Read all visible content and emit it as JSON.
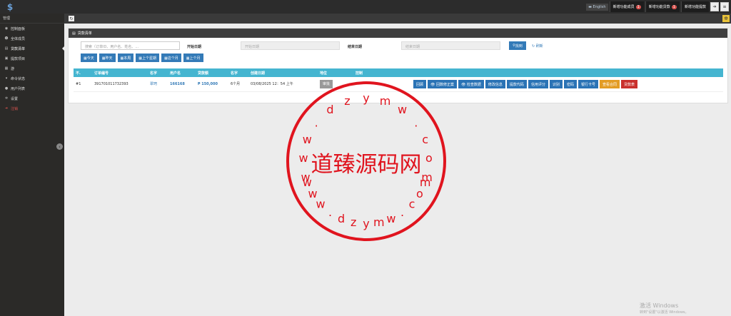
{
  "topbar": {
    "language": "English",
    "features": [
      {
        "label": "新增功能成员",
        "badge": "1"
      },
      {
        "label": "新增功能贷款",
        "badge": "1"
      },
      {
        "label": "新增功能提款",
        "badge": ""
      }
    ],
    "icons": [
      "logout-icon",
      "menu-icon"
    ]
  },
  "sidebar": {
    "header": "管理",
    "items": [
      {
        "label": "控制面板",
        "icon": "dashboard-icon"
      },
      {
        "label": "全体成员",
        "icon": "users-icon"
      },
      {
        "label": "贷款清单",
        "icon": "list-icon"
      },
      {
        "label": "提款项目",
        "icon": "money-icon"
      },
      {
        "label": "游",
        "icon": "grid-icon"
      },
      {
        "label": "命令状态",
        "icon": "cart-icon"
      },
      {
        "label": "用户列表",
        "icon": "user-icon"
      },
      {
        "label": "设置",
        "icon": "gear-icon"
      },
      {
        "label": "注销",
        "icon": "logout-icon"
      }
    ]
  },
  "panel": {
    "title": "贷款清单",
    "search_placeholder": "搜索（订单ID、用户名、姓名、...",
    "start_label": "开始日期",
    "start_placeholder": "开始日期",
    "end_label": "结束日期",
    "end_placeholder": "结束日期",
    "find_label": "找到",
    "reset_label": "刷新",
    "ranges": [
      "今天",
      "昨天",
      "本周",
      "上个星期",
      "这个月",
      "上个月"
    ]
  },
  "table": {
    "headers": [
      "不.",
      "订单编号",
      "名字",
      "用户名",
      "贷款额",
      "名字",
      "创建日期",
      "地位",
      "控制"
    ],
    "rows": [
      {
        "no": "#1",
        "order_id": "391701011732393",
        "name": "翠珂",
        "username": "166168",
        "amount": "₱ 150,000",
        "term": "6个月",
        "created": "03/08/2025 12：54 上午",
        "status": "审批",
        "actions": [
          {
            "label": "回顾",
            "style": "blue"
          },
          {
            "label": "👁 回数修正案",
            "style": "blue"
          },
          {
            "label": "👁 检查数据",
            "style": "blue"
          },
          {
            "label": "修改信息",
            "style": "blue"
          },
          {
            "label": "提款代码",
            "style": "blue"
          },
          {
            "label": "信用评分",
            "style": "blue"
          },
          {
            "label": "识别",
            "style": "blue"
          },
          {
            "label": "密码",
            "style": "blue"
          },
          {
            "label": "银行卡号",
            "style": "blue"
          },
          {
            "label": "查看合同",
            "style": "gold"
          },
          {
            "label": "贷款表",
            "style": "red"
          }
        ]
      }
    ]
  },
  "stamp": {
    "center_text": "道臻源码网",
    "top_letters": [
      "w",
      "w",
      "w",
      ".",
      "d",
      "z",
      "y",
      "m",
      "w",
      ".",
      "c",
      "o",
      "m"
    ],
    "bottom_letters": [
      "w",
      "w",
      "w",
      ".",
      "d",
      "z",
      "y",
      "m",
      "w",
      ".",
      "c",
      "o",
      "m"
    ],
    "color": "#e0141e"
  },
  "watermark": {
    "line1": "激活 Windows",
    "line2": "转到\"设置\"以激活 Windows。"
  }
}
